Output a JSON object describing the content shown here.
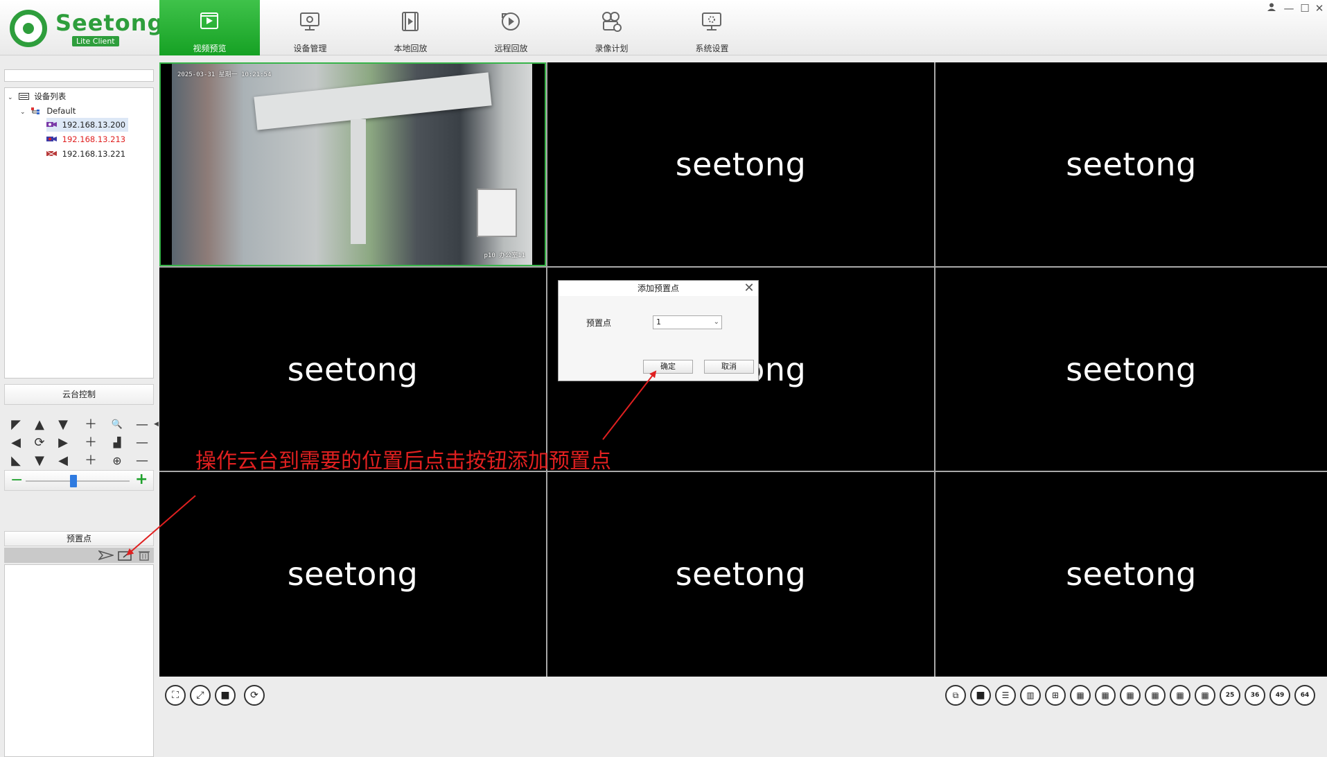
{
  "brand": {
    "name": "Seetong",
    "badge": "Lite Client"
  },
  "nav": {
    "tabs": [
      {
        "label": "视频预览",
        "icon": "video-preview-icon",
        "active": true
      },
      {
        "label": "设备管理",
        "icon": "device-manage-icon",
        "active": false
      },
      {
        "label": "本地回放",
        "icon": "local-playback-icon",
        "active": false
      },
      {
        "label": "远程回放",
        "icon": "remote-playback-icon",
        "active": false
      },
      {
        "label": "录像计划",
        "icon": "record-plan-icon",
        "active": false
      },
      {
        "label": "系统设置",
        "icon": "system-settings-icon",
        "active": false
      }
    ]
  },
  "window_controls": {
    "user": "user-icon",
    "minimize": "—",
    "maximize": "☐",
    "close": "✕"
  },
  "tree": {
    "root": "设备列表",
    "group": "Default",
    "devices": [
      {
        "ip": "192.168.13.200",
        "color": "#222222",
        "selected": true
      },
      {
        "ip": "192.168.13.213",
        "color": "#e02020",
        "selected": false
      },
      {
        "ip": "192.168.13.221",
        "color": "#222222",
        "selected": false
      }
    ]
  },
  "ptz": {
    "title": "云台控制"
  },
  "preset": {
    "title": "预置点"
  },
  "grid": {
    "watermark": "seetong",
    "camera_osd_time": "2025-03-31  星期一   10:21:54",
    "camera_osd_name": "p10 办公室11"
  },
  "dialog": {
    "title": "添加预置点",
    "field_label": "预置点",
    "field_value": "1",
    "ok": "确定",
    "cancel": "取消"
  },
  "annotation": {
    "text": "操作云台到需要的位置后点击按钮添加预置点",
    "color": "#e02020"
  },
  "bottom": {
    "layout_labels": [
      "25",
      "36",
      "49",
      "64"
    ]
  },
  "colors": {
    "accent": "#2e9e3c",
    "active_tab": "#22a82e",
    "highlight": "#37b449"
  }
}
